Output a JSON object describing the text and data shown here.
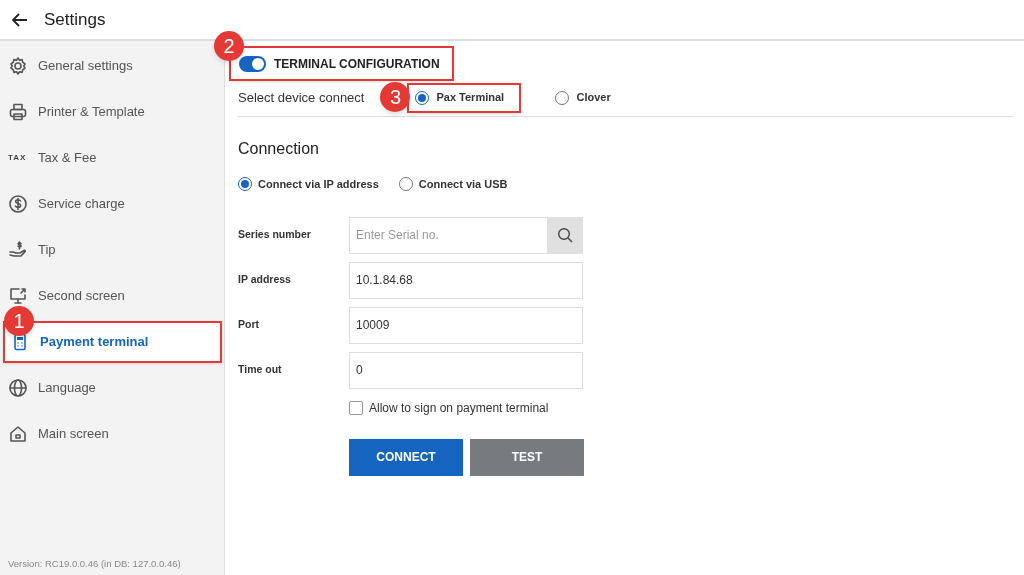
{
  "header": {
    "title": "Settings"
  },
  "sidebar": {
    "items": [
      {
        "label": "General settings",
        "selected": false
      },
      {
        "label": "Printer & Template",
        "selected": false
      },
      {
        "label": "Tax & Fee",
        "selected": false,
        "icon_text": "TAX"
      },
      {
        "label": "Service charge",
        "selected": false
      },
      {
        "label": "Tip",
        "selected": false
      },
      {
        "label": "Second screen",
        "selected": false
      },
      {
        "label": "Payment terminal",
        "selected": true,
        "callout": "1"
      },
      {
        "label": "Language",
        "selected": false
      },
      {
        "label": "Main screen",
        "selected": false
      }
    ],
    "version": "Version:  RC19.0.0.46 (in DB: 127.0.0.46)"
  },
  "terminal_toggle": {
    "label": "TERMINAL CONFIGURATION",
    "on": true,
    "callout": "2"
  },
  "device": {
    "label": "Select device connect",
    "options": [
      {
        "label": "Pax Terminal",
        "selected": true,
        "callout": "3"
      },
      {
        "label": "Clover",
        "selected": false
      }
    ]
  },
  "connection": {
    "title": "Connection",
    "options": [
      {
        "label": "Connect via IP address",
        "selected": true
      },
      {
        "label": "Connect via USB",
        "selected": false
      }
    ],
    "fields": [
      {
        "label": "Series number",
        "kind": "search",
        "placeholder": "Enter Serial no."
      },
      {
        "label": "IP address",
        "kind": "text",
        "value": "10.1.84.68"
      },
      {
        "label": "Port",
        "kind": "text",
        "value": "10009"
      },
      {
        "label": "Time out",
        "kind": "text",
        "value": "0"
      }
    ],
    "checkbox": {
      "label": "Allow to sign on payment terminal",
      "checked": false
    },
    "buttons": [
      {
        "label": "CONNECT",
        "kind": "primary"
      },
      {
        "label": "TEST",
        "kind": "secondary"
      }
    ]
  }
}
